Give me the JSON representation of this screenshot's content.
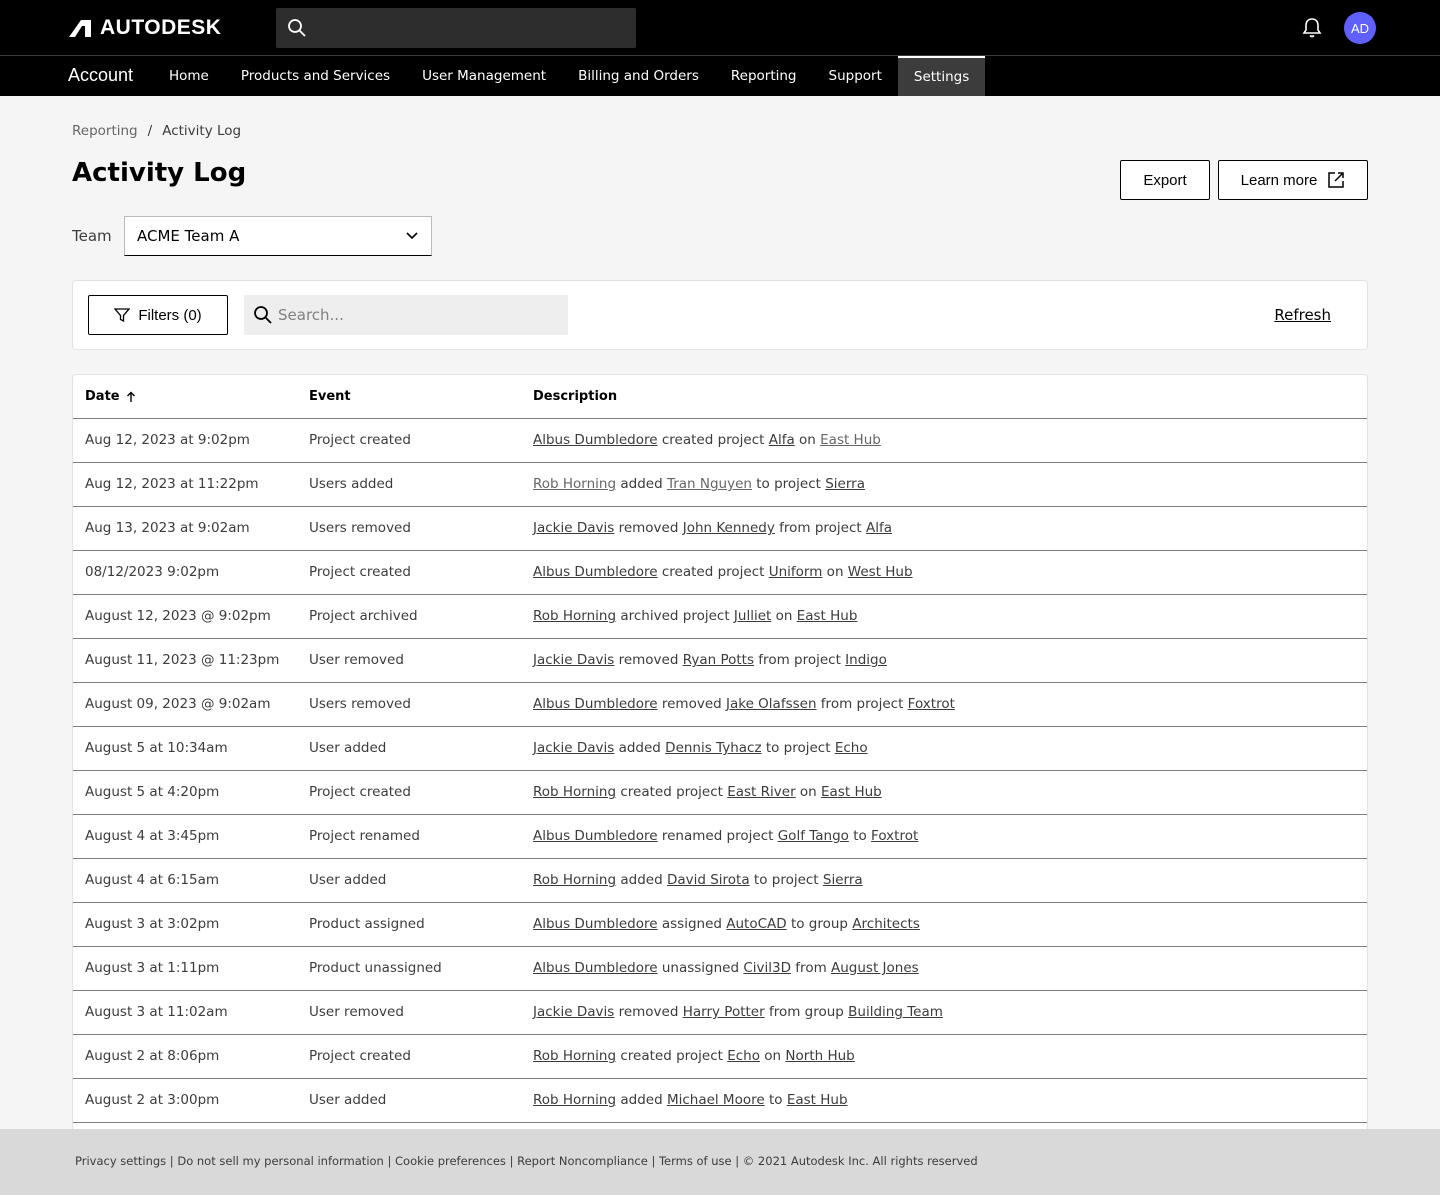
{
  "brand": {
    "logo_text": "AUTODESK"
  },
  "user": {
    "initials": "AD"
  },
  "nav": {
    "title": "Account",
    "items": [
      {
        "label": "Home"
      },
      {
        "label": "Products and Services"
      },
      {
        "label": "User Management"
      },
      {
        "label": "Billing and Orders"
      },
      {
        "label": "Reporting"
      },
      {
        "label": "Support"
      },
      {
        "label": "Settings",
        "active": true
      }
    ]
  },
  "breadcrumb": {
    "parent": "Reporting",
    "separator": "/",
    "current": "Activity Log"
  },
  "page": {
    "title": "Activity Log",
    "export_label": "Export",
    "learn_more_label": "Learn more"
  },
  "team": {
    "label": "Team",
    "selected": "ACME Team A"
  },
  "toolbar": {
    "filters_label": "Filters (0)",
    "search_placeholder": "Search...",
    "refresh_label": "Refresh"
  },
  "table": {
    "headers": {
      "date": "Date",
      "event": "Event",
      "description": "Description"
    },
    "rows": [
      {
        "date": "Aug 12, 2023 at 9:02pm",
        "event": "Project created",
        "desc": [
          {
            "t": "Albus Dumbledore",
            "l": 1
          },
          {
            "t": " created project "
          },
          {
            "t": "Alfa",
            "l": 1
          },
          {
            "t": " on "
          },
          {
            "t": "East Hub",
            "l": 1,
            "m": 1
          }
        ]
      },
      {
        "date": "Aug 12, 2023 at 11:22pm",
        "event": "Users added",
        "desc": [
          {
            "t": "Rob Horning",
            "l": 1,
            "m": 1
          },
          {
            "t": " added "
          },
          {
            "t": "Tran Nguyen",
            "l": 1,
            "m": 1
          },
          {
            "t": " to project "
          },
          {
            "t": "Sierra",
            "l": 1
          }
        ]
      },
      {
        "date": "Aug 13, 2023 at 9:02am",
        "event": "Users removed",
        "desc": [
          {
            "t": "Jackie Davis",
            "l": 1
          },
          {
            "t": " removed "
          },
          {
            "t": "John Kennedy",
            "l": 1
          },
          {
            "t": " from project "
          },
          {
            "t": "Alfa",
            "l": 1
          }
        ]
      },
      {
        "date": "08/12/2023 9:02pm",
        "event": "Project created",
        "desc": [
          {
            "t": "Albus Dumbledore",
            "l": 1
          },
          {
            "t": " created project "
          },
          {
            "t": "Uniform",
            "l": 1
          },
          {
            "t": " on "
          },
          {
            "t": "West Hub",
            "l": 1
          }
        ]
      },
      {
        "date": "August 12, 2023 @ 9:02pm",
        "event": "Project archived",
        "desc": [
          {
            "t": "Rob Horning",
            "l": 1
          },
          {
            "t": " archived project "
          },
          {
            "t": "Julliet",
            "l": 1
          },
          {
            "t": " on "
          },
          {
            "t": "East Hub",
            "l": 1
          }
        ]
      },
      {
        "date": "August 11, 2023 @ 11:23pm",
        "event": "User removed",
        "desc": [
          {
            "t": "Jackie Davis",
            "l": 1
          },
          {
            "t": " removed "
          },
          {
            "t": "Ryan Potts",
            "l": 1
          },
          {
            "t": " from project "
          },
          {
            "t": "Indigo",
            "l": 1
          }
        ]
      },
      {
        "date": "August 09, 2023 @ 9:02am",
        "event": "Users removed",
        "desc": [
          {
            "t": "Albus Dumbledore",
            "l": 1
          },
          {
            "t": " removed "
          },
          {
            "t": "Jake Olafssen",
            "l": 1
          },
          {
            "t": " from project "
          },
          {
            "t": "Foxtrot",
            "l": 1
          }
        ]
      },
      {
        "date": "August 5 at 10:34am",
        "event": "User added",
        "desc": [
          {
            "t": "Jackie Davis",
            "l": 1
          },
          {
            "t": " added "
          },
          {
            "t": "Dennis Tyhacz",
            "l": 1
          },
          {
            "t": " to project "
          },
          {
            "t": "Echo",
            "l": 1
          }
        ]
      },
      {
        "date": "August 5 at 4:20pm",
        "event": "Project created",
        "desc": [
          {
            "t": "Rob Horning",
            "l": 1
          },
          {
            "t": " created project "
          },
          {
            "t": "East River",
            "l": 1
          },
          {
            "t": " on "
          },
          {
            "t": "East Hub",
            "l": 1
          }
        ]
      },
      {
        "date": "August 4 at 3:45pm",
        "event": "Project renamed",
        "desc": [
          {
            "t": "Albus Dumbledore",
            "l": 1
          },
          {
            "t": " renamed project "
          },
          {
            "t": "Golf Tango",
            "l": 1
          },
          {
            "t": " to "
          },
          {
            "t": "Foxtrot",
            "l": 1
          }
        ]
      },
      {
        "date": "August 4 at 6:15am",
        "event": "User added",
        "desc": [
          {
            "t": "Rob Horning",
            "l": 1
          },
          {
            "t": " added "
          },
          {
            "t": "David Sirota",
            "l": 1
          },
          {
            "t": " to project "
          },
          {
            "t": "Sierra",
            "l": 1
          }
        ]
      },
      {
        "date": "August 3 at 3:02pm",
        "event": "Product assigned",
        "desc": [
          {
            "t": "Albus Dumbledore",
            "l": 1
          },
          {
            "t": " assigned "
          },
          {
            "t": "AutoCAD",
            "l": 1
          },
          {
            "t": " to group "
          },
          {
            "t": "Architects",
            "l": 1
          }
        ]
      },
      {
        "date": "August 3 at 1:11pm",
        "event": "Product unassigned",
        "desc": [
          {
            "t": "Albus Dumbledore",
            "l": 1
          },
          {
            "t": " unassigned "
          },
          {
            "t": "Civil3D",
            "l": 1
          },
          {
            "t": " from "
          },
          {
            "t": "August Jones",
            "l": 1
          }
        ]
      },
      {
        "date": "August 3 at 11:02am",
        "event": "User removed",
        "desc": [
          {
            "t": "Jackie Davis",
            "l": 1
          },
          {
            "t": " removed "
          },
          {
            "t": "Harry Potter",
            "l": 1
          },
          {
            "t": " from group "
          },
          {
            "t": "Building Team",
            "l": 1
          }
        ]
      },
      {
        "date": "August 2 at 8:06pm",
        "event": "Project created",
        "desc": [
          {
            "t": "Rob Horning",
            "l": 1
          },
          {
            "t": " created project "
          },
          {
            "t": "Echo",
            "l": 1
          },
          {
            "t": " on "
          },
          {
            "t": "North Hub",
            "l": 1
          }
        ]
      },
      {
        "date": "August 2 at 3:00pm",
        "event": "User added",
        "desc": [
          {
            "t": "Rob Horning",
            "l": 1
          },
          {
            "t": " added "
          },
          {
            "t": "Michael Moore",
            "l": 1
          },
          {
            "t": " to "
          },
          {
            "t": "East Hub",
            "l": 1
          }
        ]
      }
    ]
  },
  "footer": {
    "text": "Privacy settings | Do not sell my personal information | Cookie preferences | Report Noncompliance | Terms of use | © 2021 Autodesk Inc. All rights reserved"
  },
  "colors": {
    "header_bg": "#000000",
    "avatar_bg": "#5f60ff",
    "page_bg": "#f5f5f5",
    "footer_bg": "#d9d9d9"
  }
}
